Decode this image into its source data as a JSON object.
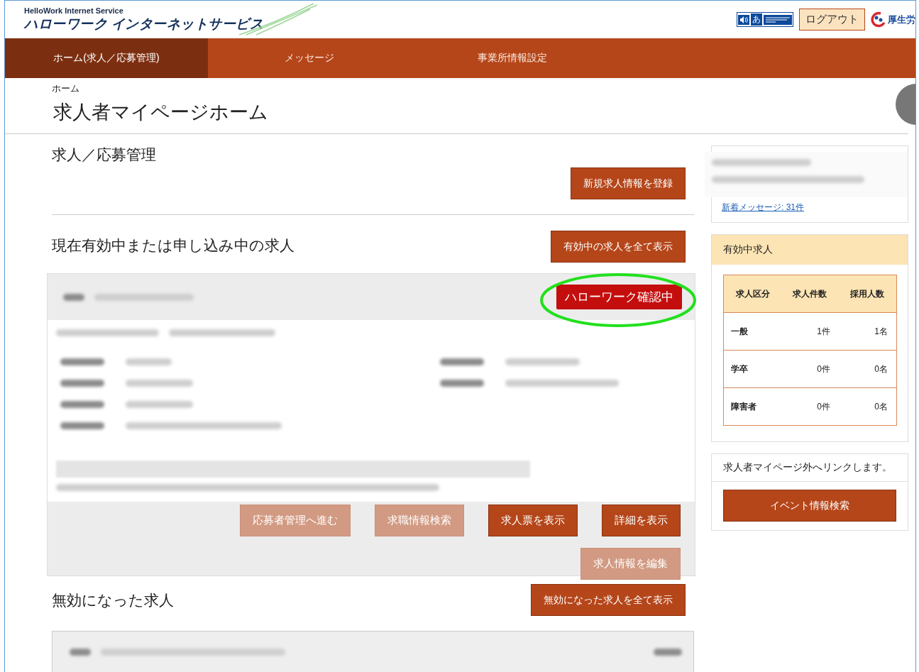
{
  "header": {
    "logo_top": "HelloWork Internet Service",
    "logo_main": "ハローワーク インターネットサービス",
    "accessibility_char": "あ",
    "logout": "ログアウト",
    "ministry": "厚生労"
  },
  "nav": [
    {
      "label": "ホーム(求人／応募管理)",
      "selected": true
    },
    {
      "label": "メッセージ",
      "selected": false
    },
    {
      "label": "事業所情報設定",
      "selected": false
    }
  ],
  "breadcrumb": "ホーム",
  "page_title": "求人者マイページホーム",
  "management": {
    "title": "求人／応募管理",
    "button": "新規求人情報を登録"
  },
  "active_jobs": {
    "title": "現在有効中または申し込み中の求人",
    "button": "有効中の求人を全て表示",
    "card": {
      "status_badge": "ハローワーク確認中",
      "buttons": [
        {
          "label": "応募者管理へ進む",
          "disabled": true
        },
        {
          "label": "求職情報検索",
          "disabled": true
        },
        {
          "label": "求人票を表示",
          "disabled": false
        },
        {
          "label": "詳細を表示",
          "disabled": false
        },
        {
          "label": "求人情報を編集",
          "disabled": true
        }
      ]
    }
  },
  "inactive_jobs": {
    "title": "無効になった求人",
    "button": "無効になった求人を全て表示"
  },
  "sidebar": {
    "message_link": "新着メッセージ: 31件",
    "summary": {
      "title": "有効中求人",
      "columns": [
        "求人区分",
        "求人件数",
        "採用人数"
      ],
      "rows": [
        [
          "一般",
          "1件",
          "1名"
        ],
        [
          "学卒",
          "0件",
          "0名"
        ],
        [
          "障害者",
          "0件",
          "0名"
        ]
      ]
    },
    "external": {
      "note": "求人者マイページ外へリンクします。",
      "button": "イベント情報検索"
    }
  }
}
